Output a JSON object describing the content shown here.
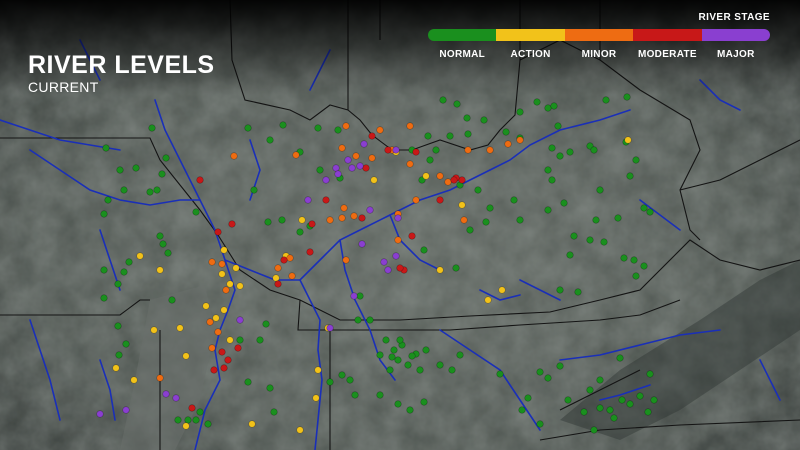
{
  "header": {
    "title": "RIVER LEVELS",
    "subtitle": "CURRENT"
  },
  "legend": {
    "title": "RIVER STAGE",
    "stages": [
      {
        "label": "NORMAL",
        "color": "#1a8f1e"
      },
      {
        "label": "ACTION",
        "color": "#f2c21a"
      },
      {
        "label": "MINOR",
        "color": "#ee6c12"
      },
      {
        "label": "MODERATE",
        "color": "#c81818"
      },
      {
        "label": "MAJOR",
        "color": "#8a3fd0"
      }
    ]
  },
  "map": {
    "background": "#3e4441",
    "land_colors": [
      "#505852",
      "#4a524d",
      "#595f5a"
    ],
    "border_color": "#111111",
    "water_color": "#1a2fb8"
  },
  "gauges_summary": {
    "normal": "green markers",
    "action": "yellow markers",
    "minor": "orange markers",
    "moderate": "red markers",
    "major": "purple markers"
  }
}
